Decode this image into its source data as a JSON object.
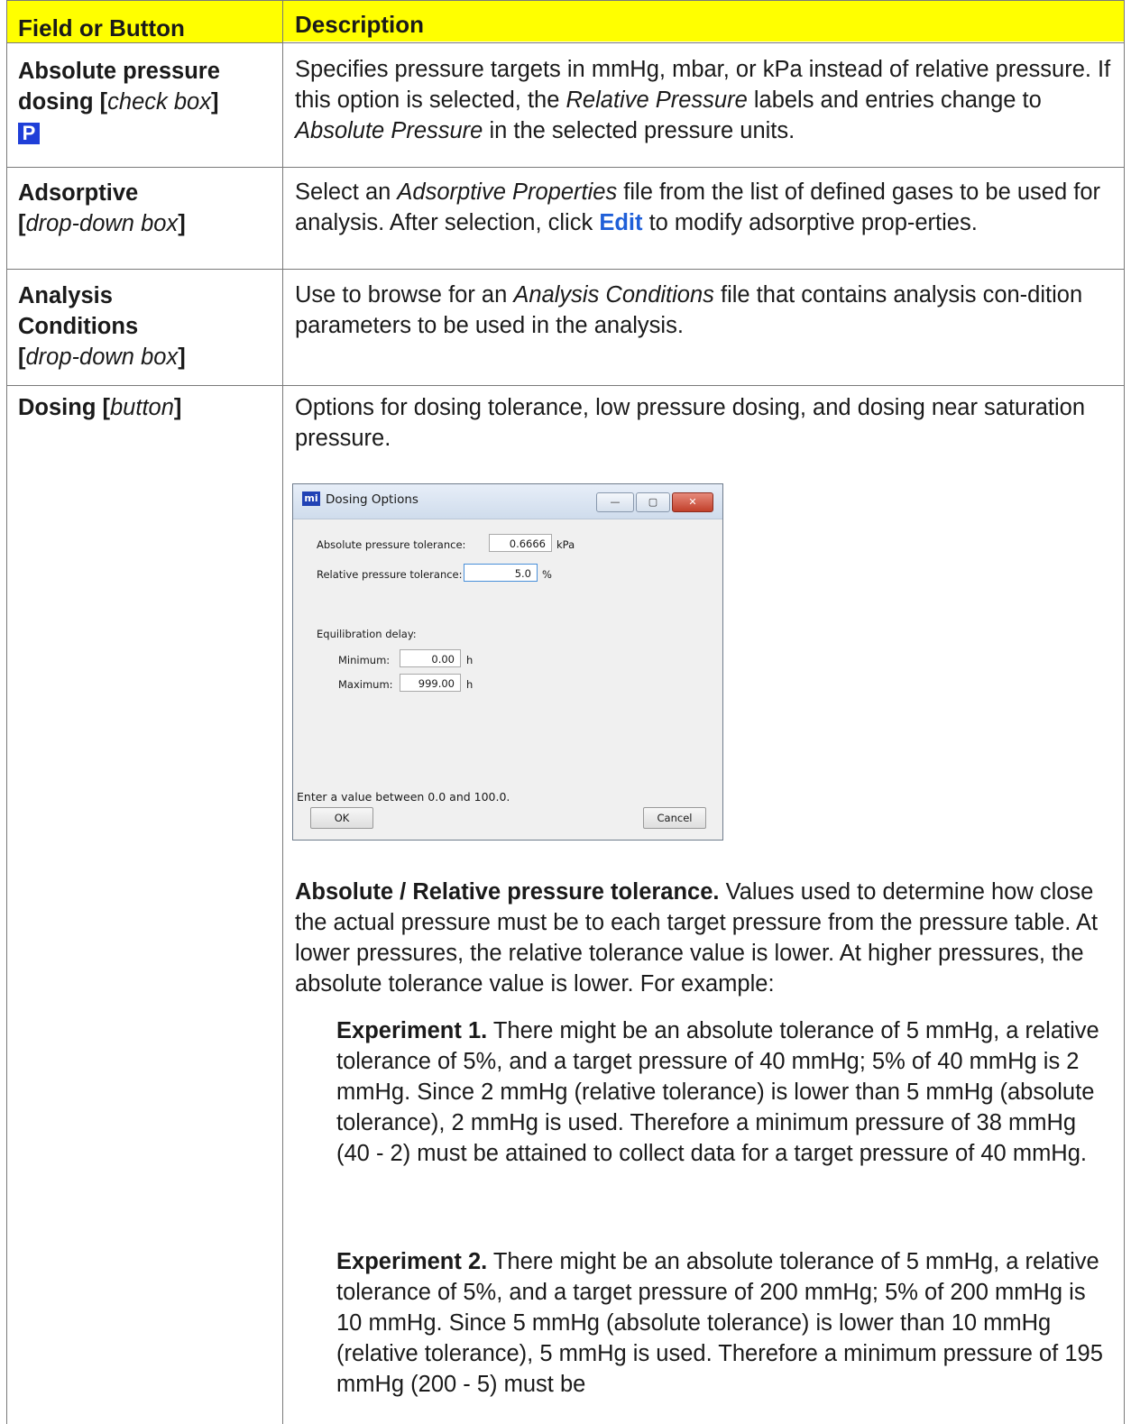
{
  "header": {
    "col1": "Field or Button",
    "col2": "Description"
  },
  "rows": [
    {
      "field_bold": "Absolute pressure dosing [",
      "field_italic": "check box",
      "field_close": "]",
      "badge": "P",
      "desc_parts": [
        "Specifies pressure targets in mmHg, mbar, or kPa instead of relative pressure. If this option is selected, the ",
        "Relative Pressure",
        " labels and entries change to ",
        "Absolute Pressure",
        " in the selected pressure units."
      ]
    },
    {
      "field_bold": "Adsorptive",
      "field_open": "[",
      "field_italic": "drop-down box",
      "field_close": "]",
      "desc_parts": [
        "Select an ",
        "Adsorptive Properties",
        " file from the list of defined gases to be used for analysis. After selection, click ",
        "Edit",
        " to modify adsorptive prop-erties."
      ]
    },
    {
      "field_bold": "Analysis Conditions",
      "field_open": "[",
      "field_italic": "drop-down box",
      "field_close": "]",
      "desc_parts": [
        "Use to browse for an ",
        "Analysis Conditions",
        " file that contains analysis con-dition parameters to be used in the analysis."
      ]
    },
    {
      "field_bold": "Dosing [",
      "field_italic": "button",
      "field_close": "]",
      "desc_intro": "Options for dosing tolerance, low pressure dosing, and dosing near saturation pressure.",
      "tolerance_title": "Absolute / Relative pressure tolerance.",
      "tolerance_text": " Values used to determine how close the actual pressure must be to each target pressure from the pressure table. At lower pressures, the relative tolerance value is lower. At higher pressures, the absolute tolerance value is lower. For example:",
      "exp1_title": "Experiment 1.",
      "exp1_text": " There might be an absolute tolerance of 5 mmHg, a relative tolerance of 5%, and a target pressure of 40 mmHg; 5% of 40 mmHg is 2 mmHg. Since 2 mmHg (relative tolerance) is lower than 5 mmHg (absolute tolerance), 2 mmHg is used. Therefore a minimum pressure of 38 mmHg (40 - 2) must be attained to collect data for a target pressure of 40 mmHg.",
      "exp2_title": "Experiment 2.",
      "exp2_text": " There might be an absolute tolerance of 5 mmHg, a relative tolerance of 5%, and a target pressure of 200 mmHg; 5% of 200 mmHg is 10 mmHg. Since 5 mmHg (absolute tolerance) is lower than 10 mmHg (relative tolerance), 5 mmHg is used. Therefore a minimum pressure of 195 mmHg (200 - 5) must be"
    }
  ],
  "dialog": {
    "app_icon": "mi",
    "title": "Dosing Options",
    "minimize": "—",
    "maximize": "▢",
    "close": "✕",
    "abs_label": "Absolute pressure tolerance:",
    "abs_value": "0.6666",
    "abs_unit": "kPa",
    "rel_label": "Relative pressure tolerance:",
    "rel_value": "5.0",
    "rel_unit": "%",
    "equil_label": "Equilibration delay:",
    "min_label": "Minimum:",
    "min_value": "0.00",
    "min_unit": "h",
    "max_label": "Maximum:",
    "max_value": "999.00",
    "max_unit": "h",
    "status": "Enter a value between 0.0 and 100.0.",
    "ok": "OK",
    "cancel": "Cancel"
  }
}
